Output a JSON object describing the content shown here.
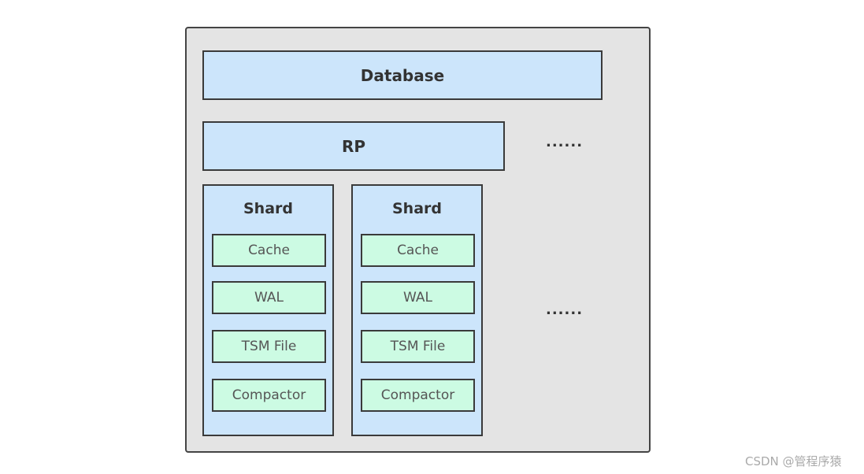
{
  "database": "Database",
  "rp": "RP",
  "ellipsis_rp": "......",
  "ellipsis_shard": "......",
  "shards": [
    {
      "title": "Shard",
      "components": [
        "Cache",
        "WAL",
        "TSM File",
        "Compactor"
      ]
    },
    {
      "title": "Shard",
      "components": [
        "Cache",
        "WAL",
        "TSM File",
        "Compactor"
      ]
    }
  ],
  "watermark": "CSDN @管程序猿"
}
